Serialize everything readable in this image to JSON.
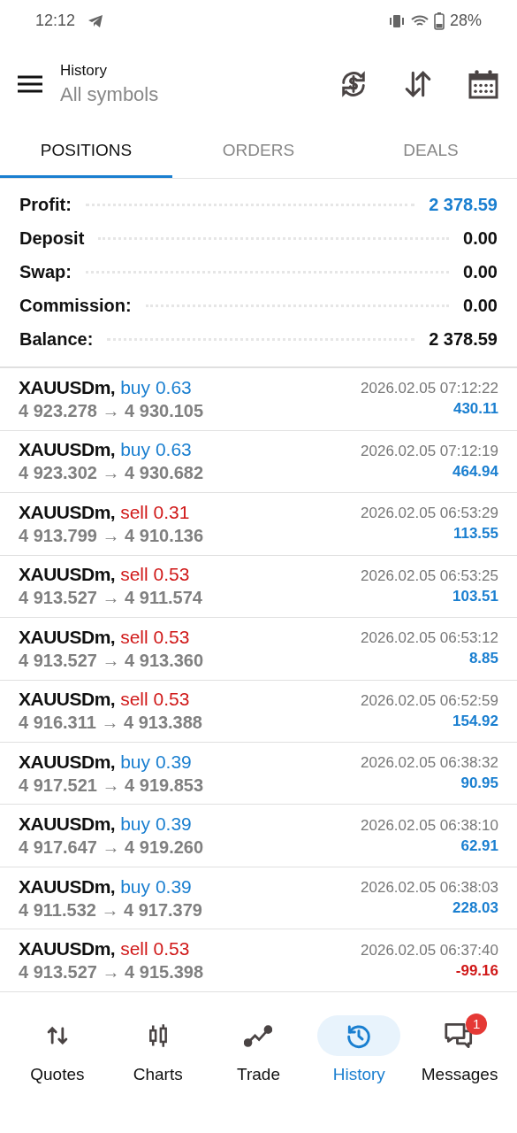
{
  "status_bar": {
    "time": "12:12",
    "battery": "28%"
  },
  "header": {
    "title": "History",
    "subtitle": "All symbols"
  },
  "tabs": [
    {
      "label": "POSITIONS",
      "selected": true
    },
    {
      "label": "ORDERS",
      "selected": false
    },
    {
      "label": "DEALS",
      "selected": false
    }
  ],
  "summary": [
    {
      "label": "Profit:",
      "value": "2 378.59",
      "highlight": true
    },
    {
      "label": "Deposit",
      "value": "0.00",
      "highlight": false
    },
    {
      "label": "Swap:",
      "value": "0.00",
      "highlight": false
    },
    {
      "label": "Commission:",
      "value": "0.00",
      "highlight": false
    },
    {
      "label": "Balance:",
      "value": "2 378.59",
      "highlight": false
    }
  ],
  "positions": [
    {
      "kind": "gain",
      "symbol": "XAUUSDm,",
      "type": "buy",
      "volume": "0.63",
      "open": "4 923.278",
      "arrow": "→",
      "close": "4 930.105",
      "time": "2026.02.05 07:12:22",
      "profit": "430.11"
    },
    {
      "kind": "gain",
      "symbol": "XAUUSDm,",
      "type": "buy",
      "volume": "0.63",
      "open": "4 923.302",
      "arrow": "→",
      "close": "4 930.682",
      "time": "2026.02.05 07:12:19",
      "profit": "464.94"
    },
    {
      "kind": "gain",
      "symbol": "XAUUSDm,",
      "type": "sell",
      "volume": "0.31",
      "open": "4 913.799",
      "arrow": "→",
      "close": "4 910.136",
      "time": "2026.02.05 06:53:29",
      "profit": "113.55"
    },
    {
      "kind": "gain",
      "symbol": "XAUUSDm,",
      "type": "sell",
      "volume": "0.53",
      "open": "4 913.527",
      "arrow": "→",
      "close": "4 911.574",
      "time": "2026.02.05 06:53:25",
      "profit": "103.51"
    },
    {
      "kind": "gain",
      "symbol": "XAUUSDm,",
      "type": "sell",
      "volume": "0.53",
      "open": "4 913.527",
      "arrow": "→",
      "close": "4 913.360",
      "time": "2026.02.05 06:53:12",
      "profit": "8.85"
    },
    {
      "kind": "gain",
      "symbol": "XAUUSDm,",
      "type": "sell",
      "volume": "0.53",
      "open": "4 916.311",
      "arrow": "→",
      "close": "4 913.388",
      "time": "2026.02.05 06:52:59",
      "profit": "154.92"
    },
    {
      "kind": "gain",
      "symbol": "XAUUSDm,",
      "type": "buy",
      "volume": "0.39",
      "open": "4 917.521",
      "arrow": "→",
      "close": "4 919.853",
      "time": "2026.02.05 06:38:32",
      "profit": "90.95"
    },
    {
      "kind": "gain",
      "symbol": "XAUUSDm,",
      "type": "buy",
      "volume": "0.39",
      "open": "4 917.647",
      "arrow": "→",
      "close": "4 919.260",
      "time": "2026.02.05 06:38:10",
      "profit": "62.91"
    },
    {
      "kind": "gain",
      "symbol": "XAUUSDm,",
      "type": "buy",
      "volume": "0.39",
      "open": "4 911.532",
      "arrow": "→",
      "close": "4 917.379",
      "time": "2026.02.05 06:38:03",
      "profit": "228.03"
    },
    {
      "kind": "loss",
      "symbol": "XAUUSDm,",
      "type": "sell",
      "volume": "0.53",
      "open": "4 913.527",
      "arrow": "→",
      "close": "4 915.398",
      "time": "2026.02.05 06:37:40",
      "profit": "-99.16"
    }
  ],
  "bottom_nav": [
    {
      "kind": "quotes",
      "label": "Quotes",
      "selected": false
    },
    {
      "kind": "charts",
      "label": "Charts",
      "selected": false
    },
    {
      "kind": "trade",
      "label": "Trade",
      "selected": false
    },
    {
      "kind": "history",
      "label": "History",
      "selected": true
    },
    {
      "kind": "messages",
      "label": "Messages",
      "selected": false,
      "badge": "1"
    }
  ]
}
